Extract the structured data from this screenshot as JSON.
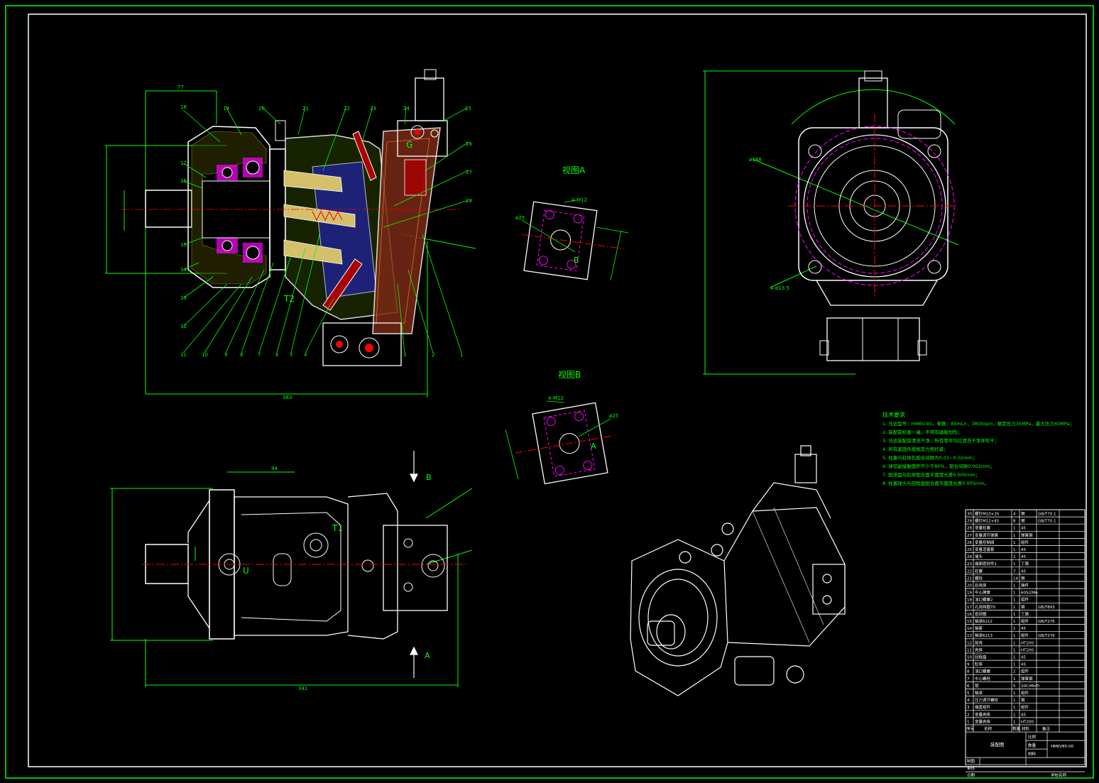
{
  "views": {
    "view_a_title": "视图A",
    "view_b_title": "视图B",
    "port_labels": {
      "g": "G",
      "t2": "T2",
      "t1": "T1",
      "u": "U",
      "b": "B",
      "a": "A"
    },
    "callouts": {
      "view_a_thread": "4-M12",
      "view_a_bore": "ø25",
      "view_b_thread": "4-M12",
      "view_b_bore": "ø25",
      "mount_holes": "4-ø13.5",
      "pitch_circle": "ø188"
    },
    "dims": {
      "top_width": "77",
      "overall_length": "383",
      "front_width": "94",
      "bottom_length": "341"
    },
    "part_numbers_left": [
      "18",
      "17",
      "16",
      "15",
      "14",
      "13",
      "12",
      "11",
      "10",
      "9",
      "8"
    ],
    "part_numbers_bottom": [
      "7",
      "6",
      "5",
      "4",
      "3",
      "2",
      "1"
    ],
    "part_numbers_top": [
      "19",
      "20",
      "21",
      "22",
      "23",
      "24",
      "25",
      "26",
      "27",
      "28"
    ]
  },
  "tech_notes": {
    "title": "技术要求",
    "lines": [
      "1. 马达型号：HM6V-85，参数：85mL/r，3800rpm，额定压力35MPa，最大压力40MPa；",
      "2. 装配前检查一遍，不得有磕碰划伤；",
      "3. 马达装配前清洗干净，所有零件均应清洗干净并吹干；",
      "4. 所有紧固件按规定力矩拧紧；",
      "5. 柱塞与缸体孔配合间隙为0.01~0.02mm；",
      "6. 球铰副接触面积不少于80%，配合间隙0.002mm；",
      "7. 配流盘与缸体配合面平面度允差0.005mm；",
      "8. 柱塞球头与回程盘配合面平面度允差0.005mm。"
    ]
  },
  "bom": {
    "rows": [
      [
        "30",
        "螺钉M10×35",
        "4",
        "钢",
        "GB/T70.1"
      ],
      [
        "29",
        "螺钉M12×45",
        "8",
        "钢",
        "GB/T70.1"
      ],
      [
        "28",
        "变量柱塞",
        "1",
        "45",
        ""
      ],
      [
        "27",
        "变量调节弹簧",
        "1",
        "弹簧钢",
        ""
      ],
      [
        "26",
        "变量控制阀",
        "1",
        "组件",
        ""
      ],
      [
        "25",
        "变量活塞套",
        "1",
        "45",
        ""
      ],
      [
        "24",
        "堵头",
        "1",
        "45",
        ""
      ],
      [
        "23",
        "端面密封件1",
        "1",
        "丁腈",
        ""
      ],
      [
        "22",
        "柱塞",
        "7",
        "45",
        ""
      ],
      [
        "21",
        "螺栓",
        "14",
        "钢",
        ""
      ],
      [
        "20",
        "后壳体",
        "1",
        "铸件",
        ""
      ],
      [
        "19",
        "中心弹簧",
        "1",
        "60Si2Mn",
        ""
      ],
      [
        "18",
        "油口螺塞2",
        "1",
        "组件",
        ""
      ],
      [
        "17",
        "孔用挡圈70",
        "1",
        "钢",
        "GB/T893"
      ],
      [
        "16",
        "密封圈",
        "1",
        "丁腈",
        ""
      ],
      [
        "15",
        "轴承6212",
        "1",
        "组件",
        "GB/T276"
      ],
      [
        "14",
        "轴套",
        "1",
        "45",
        ""
      ],
      [
        "13",
        "轴承6213",
        "1",
        "组件",
        "GB/T276"
      ],
      [
        "12",
        "前壳",
        "1",
        "HT200",
        ""
      ],
      [
        "11",
        "壳体",
        "1",
        "HT200",
        ""
      ],
      [
        "10",
        "回程盘",
        "1",
        "45",
        ""
      ],
      [
        "9",
        "缸体",
        "1",
        "45",
        ""
      ],
      [
        "8",
        "油口螺塞",
        "2",
        "组件",
        ""
      ],
      [
        "7",
        "中心螺栓",
        "1",
        "弹簧钢",
        ""
      ],
      [
        "6",
        "销",
        "5",
        "20CrMnTi",
        ""
      ],
      [
        "5",
        "轴承",
        "1",
        "组件",
        ""
      ],
      [
        "4",
        "压力调节螺栓",
        "1",
        "钢",
        ""
      ],
      [
        "3",
        "端盖组件",
        "1",
        "组件",
        ""
      ],
      [
        "2",
        "变量壳体",
        "1",
        "45",
        ""
      ],
      [
        "1",
        "变量壳体",
        "1",
        "HT200",
        ""
      ]
    ],
    "header": [
      "序号",
      "名称",
      "数量",
      "材料",
      "备注"
    ],
    "title_block": {
      "drawing_title": "装配图",
      "drawing_code": "HM6V85-00",
      "scale_label": "比例",
      "qty_label": "数量",
      "material_label": "材料",
      "designer_label": "制图",
      "checker_label": "审核",
      "date_label": "日期",
      "school": "学校名称"
    }
  },
  "colors": {
    "border": "#00ff00",
    "outline": "#ffffff",
    "dimension": "#00ff00",
    "centerline": "#ff0000",
    "hatch": "#ff00ff",
    "annotation_text": "#00ff00"
  }
}
